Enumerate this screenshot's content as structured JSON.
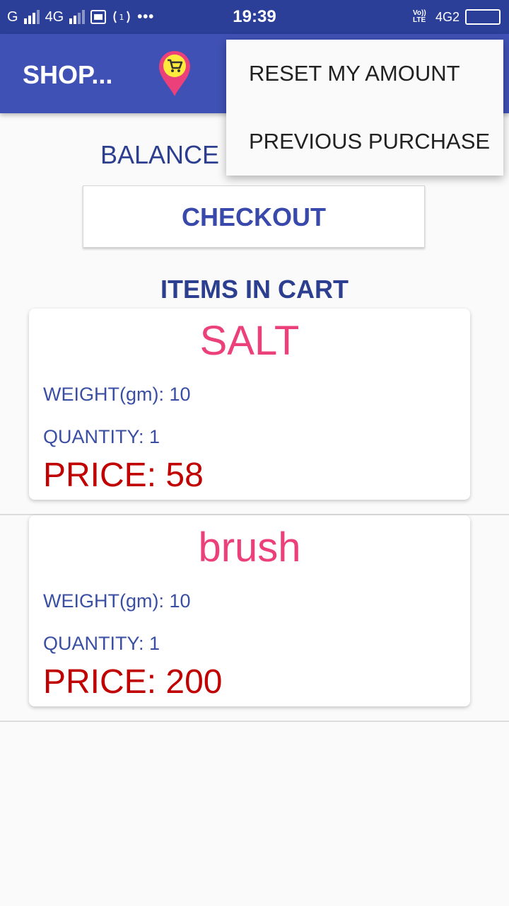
{
  "status_bar": {
    "carrier1": "G",
    "carrier2": "4G",
    "time": "19:39",
    "volte": "Vo)) LTE",
    "network": "4G2",
    "icons": [
      "signal-icon",
      "image-icon",
      "hotspot-icon",
      "more-icon",
      "battery-icon"
    ]
  },
  "app_bar": {
    "title": "SHOP...",
    "logo_icon": "cart-location-pin-icon",
    "accent": "#3f51b5"
  },
  "overflow_menu": {
    "items": [
      "RESET MY AMOUNT",
      "PREVIOUS PURCHASE"
    ]
  },
  "balance": {
    "label": "BALANCE :"
  },
  "checkout": {
    "label": "CHECKOUT"
  },
  "cart": {
    "heading": "ITEMS IN CART",
    "items": [
      {
        "name": "SALT",
        "weight": "WEIGHT(gm): 10",
        "quantity": "QUANTITY: 1",
        "price": "PRICE: 58"
      },
      {
        "name": "brush",
        "weight": "WEIGHT(gm): 10",
        "quantity": "QUANTITY: 1",
        "price": "PRICE: 200"
      }
    ]
  },
  "colors": {
    "status_bar": "#2b3f99",
    "primary": "#3f51b5",
    "item_name": "#ec407a",
    "price": "#c00000",
    "label": "#3a4fa3"
  }
}
